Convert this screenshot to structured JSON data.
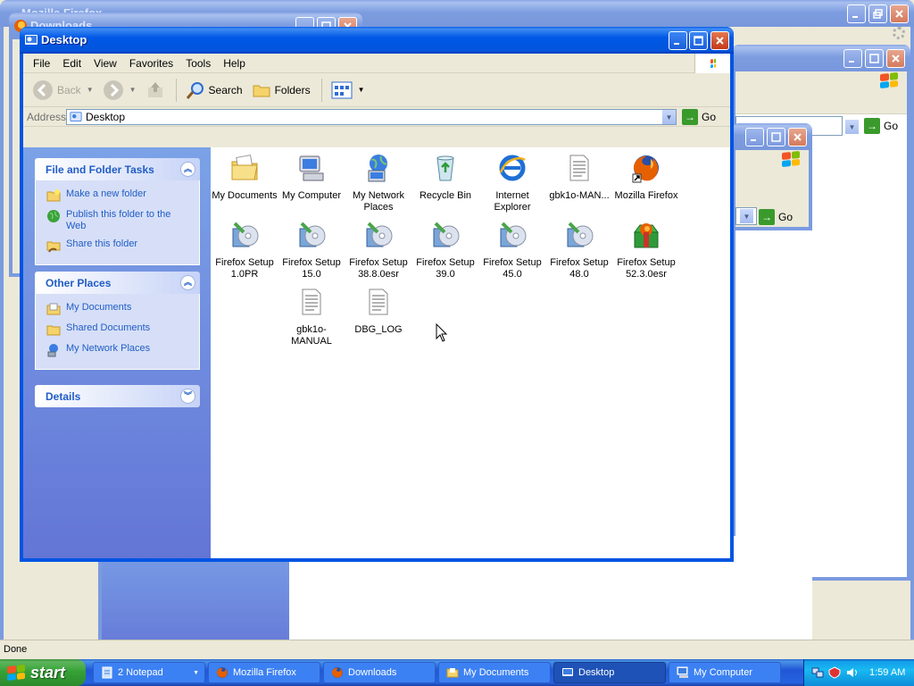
{
  "background_windows": {
    "firefox_title": "Mozilla Firefox",
    "downloads_title": "Downloads",
    "go_label": "Go"
  },
  "window": {
    "title": "Desktop",
    "menu": [
      "File",
      "Edit",
      "View",
      "Favorites",
      "Tools",
      "Help"
    ],
    "toolbar": {
      "back": "Back",
      "search": "Search",
      "folders": "Folders"
    },
    "address": {
      "label": "Address",
      "value": "Desktop",
      "go": "Go"
    }
  },
  "taskpane": {
    "file_tasks": {
      "title": "File and Folder Tasks",
      "items": [
        "Make a new folder",
        "Publish this folder to the Web",
        "Share this folder"
      ]
    },
    "other_places": {
      "title": "Other Places",
      "items": [
        "My Documents",
        "Shared Documents",
        "My Network Places"
      ]
    },
    "details": {
      "title": "Details"
    }
  },
  "files": [
    {
      "label": "My Documents",
      "icon": "my-documents-icon"
    },
    {
      "label": "My Computer",
      "icon": "my-computer-icon"
    },
    {
      "label": "My Network Places",
      "icon": "network-places-icon"
    },
    {
      "label": "Recycle Bin",
      "icon": "recycle-bin-icon"
    },
    {
      "label": "Internet Explorer",
      "icon": "internet-explorer-icon"
    },
    {
      "label": "gbk1o-MAN...",
      "icon": "text-file-icon"
    },
    {
      "label": "Mozilla Firefox",
      "icon": "firefox-shortcut-icon"
    },
    {
      "label": "Firefox Setup 1.0PR",
      "icon": "setup-icon"
    },
    {
      "label": "Firefox Setup 15.0",
      "icon": "setup-icon"
    },
    {
      "label": "Firefox Setup 38.8.0esr",
      "icon": "setup-icon"
    },
    {
      "label": "Firefox Setup 39.0",
      "icon": "setup-icon"
    },
    {
      "label": "Firefox Setup 45.0",
      "icon": "setup-icon"
    },
    {
      "label": "Firefox Setup 48.0",
      "icon": "setup-icon"
    },
    {
      "label": "Firefox Setup 52.3.0esr",
      "icon": "firefox-setup-icon"
    },
    {
      "label": "gbk1o-MANUAL",
      "icon": "text-file-icon"
    },
    {
      "label": "DBG_LOG",
      "icon": "text-file-icon"
    }
  ],
  "statusbar": {
    "text": "Done"
  },
  "taskbar": {
    "start": "start",
    "tasks": [
      {
        "label": "2 Notepad",
        "icon": "notepad-icon",
        "active": false
      },
      {
        "label": "Mozilla Firefox",
        "icon": "firefox-icon",
        "active": false
      },
      {
        "label": "Downloads",
        "icon": "firefox-icon",
        "active": false
      },
      {
        "label": "My Documents",
        "icon": "folder-icon",
        "active": false
      },
      {
        "label": "Desktop",
        "icon": "desktop-icon",
        "active": true
      },
      {
        "label": "My Computer",
        "icon": "computer-icon",
        "active": false
      }
    ],
    "clock": "1:59 AM"
  },
  "colors": {
    "title_active": "#0054e3",
    "taskpane_link": "#215dc6",
    "taskbar": "#245edb",
    "start_green": "#3c9a3c"
  }
}
